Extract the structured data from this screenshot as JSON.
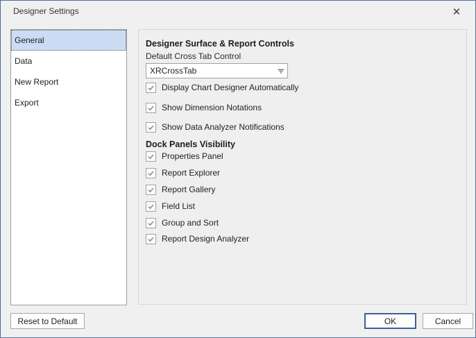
{
  "window": {
    "title": "Designer Settings",
    "close_icon": "✕"
  },
  "sidebar": {
    "items": [
      {
        "label": "General",
        "selected": true
      },
      {
        "label": "Data",
        "selected": false
      },
      {
        "label": "New Report",
        "selected": false
      },
      {
        "label": "Export",
        "selected": false
      }
    ]
  },
  "panel": {
    "section1": {
      "heading": "Designer Surface & Report Controls",
      "combo_label": "Default Cross Tab Control",
      "combo_value": "XRCrossTab",
      "checkboxes": [
        {
          "label": "Display Chart Designer Automatically",
          "checked": true
        },
        {
          "label": "Show Dimension Notations",
          "checked": true
        },
        {
          "label": "Show Data Analyzer Notifications",
          "checked": true
        }
      ]
    },
    "section2": {
      "heading": "Dock Panels Visibility",
      "checkboxes": [
        {
          "label": "Properties Panel",
          "checked": true
        },
        {
          "label": "Report Explorer",
          "checked": true
        },
        {
          "label": "Report Gallery",
          "checked": true
        },
        {
          "label": "Field List",
          "checked": true
        },
        {
          "label": "Group and Sort",
          "checked": true
        },
        {
          "label": "Report Design Analyzer",
          "checked": true
        }
      ]
    }
  },
  "buttons": {
    "reset": "Reset to Default",
    "ok": "OK",
    "cancel": "Cancel"
  },
  "colors": {
    "accent": "#3b6095",
    "selection": "#ccdcf5",
    "dialog_border": "#4d6d9d",
    "check": "#8a8a8a"
  }
}
